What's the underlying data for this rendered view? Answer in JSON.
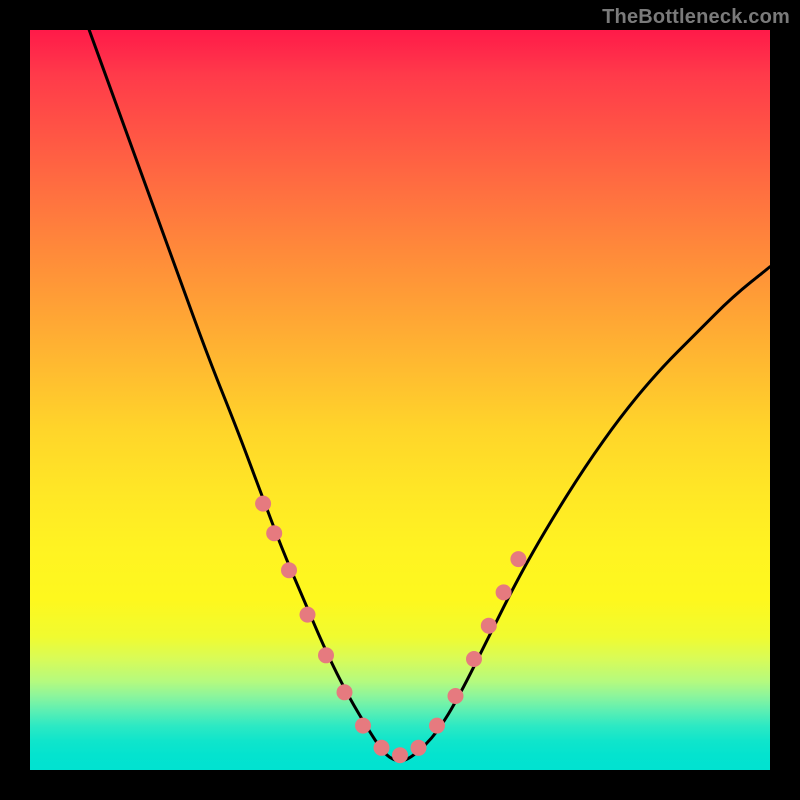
{
  "watermark": "TheBottleneck.com",
  "colors": {
    "bg": "#000000",
    "curve": "#000000",
    "marker_fill": "#e67a7f",
    "marker_stroke": "#cf5b62"
  },
  "chart_data": {
    "type": "line",
    "title": "",
    "xlabel": "",
    "ylabel": "",
    "xlim": [
      0,
      100
    ],
    "ylim": [
      0,
      100
    ],
    "grid": false,
    "series": [
      {
        "name": "bottleneck-curve",
        "x": [
          8,
          12,
          16,
          20,
          24,
          28,
          31,
          34,
          37,
          40,
          43,
          46,
          48,
          50,
          52,
          55,
          58,
          62,
          66,
          70,
          75,
          80,
          85,
          90,
          95,
          100
        ],
        "y": [
          100,
          89,
          78,
          67,
          56,
          46,
          38,
          30,
          23,
          16,
          10,
          5,
          2,
          1,
          2,
          5,
          10,
          18,
          26,
          33,
          41,
          48,
          54,
          59,
          64,
          68
        ]
      }
    ],
    "markers": {
      "name": "highlighted-points",
      "x": [
        31.5,
        33,
        35,
        37.5,
        40,
        42.5,
        45,
        47.5,
        50,
        52.5,
        55,
        57.5,
        60,
        62,
        64,
        66
      ],
      "y": [
        36,
        32,
        27,
        21,
        15.5,
        10.5,
        6,
        3,
        2,
        3,
        6,
        10,
        15,
        19.5,
        24,
        28.5
      ]
    }
  }
}
